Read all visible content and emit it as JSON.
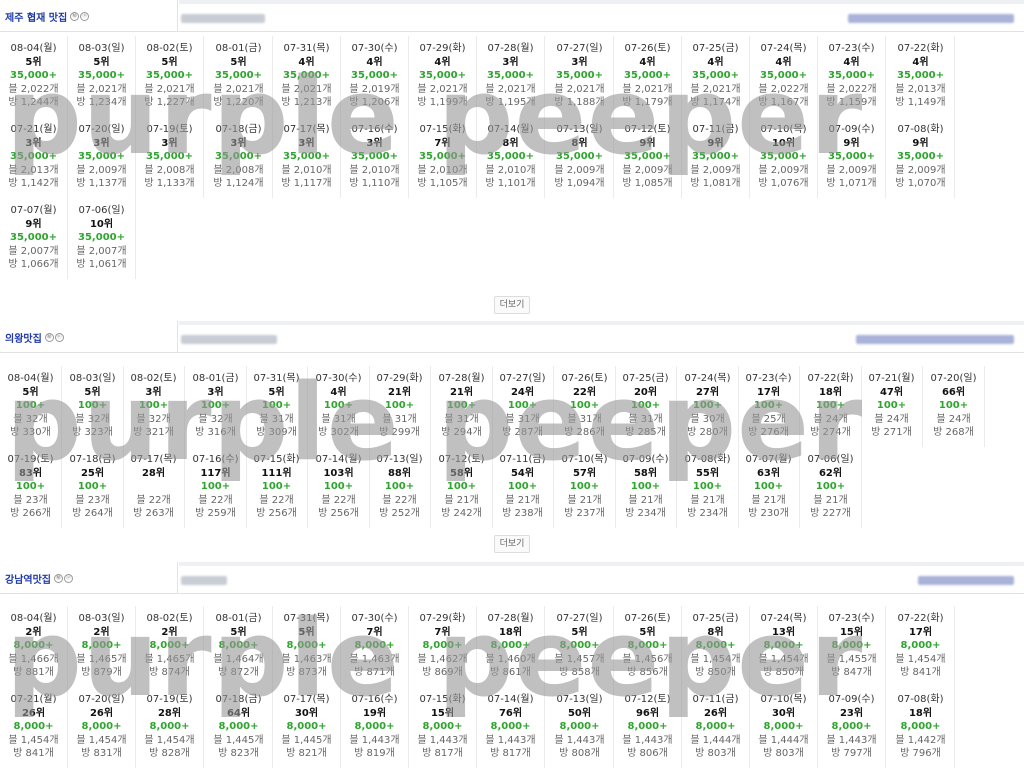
{
  "more_label": "더보기",
  "watermark_text": "purple peeper",
  "colors": {
    "keyword": "#1f3aa8",
    "price": "#2fa52f"
  },
  "sections": [
    {
      "title": "제주 협재 맛집",
      "badges": [
        "㊙",
        "ⓟ"
      ],
      "items": [
        {
          "date": "08-04(월)",
          "rank": "5위",
          "price": "35,000+",
          "blog": "블 2,022개",
          "cafe": "방 1,244개"
        },
        {
          "date": "08-03(일)",
          "rank": "5위",
          "price": "35,000+",
          "blog": "블 2,021개",
          "cafe": "방 1,234개"
        },
        {
          "date": "08-02(토)",
          "rank": "5위",
          "price": "35,000+",
          "blog": "블 2,021개",
          "cafe": "방 1,227개"
        },
        {
          "date": "08-01(금)",
          "rank": "5위",
          "price": "35,000+",
          "blog": "블 2,021개",
          "cafe": "방 1,220개"
        },
        {
          "date": "07-31(목)",
          "rank": "4위",
          "price": "35,000+",
          "blog": "블 2,021개",
          "cafe": "방 1,213개"
        },
        {
          "date": "07-30(수)",
          "rank": "4위",
          "price": "35,000+",
          "blog": "블 2,019개",
          "cafe": "방 1,206개"
        },
        {
          "date": "07-29(화)",
          "rank": "4위",
          "price": "35,000+",
          "blog": "블 2,021개",
          "cafe": "방 1,199개"
        },
        {
          "date": "07-28(월)",
          "rank": "3위",
          "price": "35,000+",
          "blog": "블 2,021개",
          "cafe": "방 1,195개"
        },
        {
          "date": "07-27(일)",
          "rank": "3위",
          "price": "35,000+",
          "blog": "블 2,021개",
          "cafe": "방 1,188개"
        },
        {
          "date": "07-26(토)",
          "rank": "4위",
          "price": "35,000+",
          "blog": "블 2,021개",
          "cafe": "방 1,179개"
        },
        {
          "date": "07-25(금)",
          "rank": "4위",
          "price": "35,000+",
          "blog": "블 2,021개",
          "cafe": "방 1,174개"
        },
        {
          "date": "07-24(목)",
          "rank": "4위",
          "price": "35,000+",
          "blog": "블 2,022개",
          "cafe": "방 1,167개"
        },
        {
          "date": "07-23(수)",
          "rank": "4위",
          "price": "35,000+",
          "blog": "블 2,022개",
          "cafe": "방 1,159개"
        },
        {
          "date": "07-22(화)",
          "rank": "4위",
          "price": "35,000+",
          "blog": "블 2,013개",
          "cafe": "방 1,149개"
        },
        {
          "date": "07-21(월)",
          "rank": "3위",
          "price": "35,000+",
          "blog": "블 2,013개",
          "cafe": "방 1,142개"
        },
        {
          "date": "07-20(일)",
          "rank": "3위",
          "price": "35,000+",
          "blog": "블 2,009개",
          "cafe": "방 1,137개"
        },
        {
          "date": "07-19(토)",
          "rank": "3위",
          "price": "35,000+",
          "blog": "블 2,008개",
          "cafe": "방 1,133개"
        },
        {
          "date": "07-18(금)",
          "rank": "3위",
          "price": "35,000+",
          "blog": "블 2,008개",
          "cafe": "방 1,124개"
        },
        {
          "date": "07-17(목)",
          "rank": "3위",
          "price": "35,000+",
          "blog": "블 2,010개",
          "cafe": "방 1,117개"
        },
        {
          "date": "07-16(수)",
          "rank": "3위",
          "price": "35,000+",
          "blog": "블 2,010개",
          "cafe": "방 1,110개"
        },
        {
          "date": "07-15(화)",
          "rank": "7위",
          "price": "35,000+",
          "blog": "블 2,010개",
          "cafe": "방 1,105개"
        },
        {
          "date": "07-14(월)",
          "rank": "8위",
          "price": "35,000+",
          "blog": "블 2,010개",
          "cafe": "방 1,101개"
        },
        {
          "date": "07-13(일)",
          "rank": "8위",
          "price": "35,000+",
          "blog": "블 2,009개",
          "cafe": "방 1,094개"
        },
        {
          "date": "07-12(토)",
          "rank": "9위",
          "price": "35,000+",
          "blog": "블 2,009개",
          "cafe": "방 1,085개"
        },
        {
          "date": "07-11(금)",
          "rank": "9위",
          "price": "35,000+",
          "blog": "블 2,009개",
          "cafe": "방 1,081개"
        },
        {
          "date": "07-10(목)",
          "rank": "10위",
          "price": "35,000+",
          "blog": "블 2,009개",
          "cafe": "방 1,076개"
        },
        {
          "date": "07-09(수)",
          "rank": "9위",
          "price": "35,000+",
          "blog": "블 2,009개",
          "cafe": "방 1,071개"
        },
        {
          "date": "07-08(화)",
          "rank": "9위",
          "price": "35,000+",
          "blog": "블 2,009개",
          "cafe": "방 1,070개"
        },
        {
          "date": "07-07(월)",
          "rank": "9위",
          "price": "35,000+",
          "blog": "블 2,007개",
          "cafe": "방 1,066개"
        },
        {
          "date": "07-06(일)",
          "rank": "10위",
          "price": "35,000+",
          "blog": "블 2,007개",
          "cafe": "방 1,061개"
        }
      ]
    },
    {
      "title": "의왕맛집",
      "badges": [
        "㊙",
        "ⓟ"
      ],
      "items": [
        {
          "date": "08-04(월)",
          "rank": "5위",
          "price": "100+",
          "blog": "블 32개",
          "cafe": "방 330개"
        },
        {
          "date": "08-03(일)",
          "rank": "5위",
          "price": "100+",
          "blog": "블 32개",
          "cafe": "방 323개"
        },
        {
          "date": "08-02(토)",
          "rank": "3위",
          "price": "100+",
          "blog": "블 32개",
          "cafe": "방 321개"
        },
        {
          "date": "08-01(금)",
          "rank": "3위",
          "price": "100+",
          "blog": "블 32개",
          "cafe": "방 316개"
        },
        {
          "date": "07-31(목)",
          "rank": "5위",
          "price": "100+",
          "blog": "블 31개",
          "cafe": "방 309개"
        },
        {
          "date": "07-30(수)",
          "rank": "4위",
          "price": "100+",
          "blog": "블 31개",
          "cafe": "방 302개"
        },
        {
          "date": "07-29(화)",
          "rank": "21위",
          "price": "100+",
          "blog": "블 31개",
          "cafe": "방 299개"
        },
        {
          "date": "07-28(월)",
          "rank": "21위",
          "price": "100+",
          "blog": "블 31개",
          "cafe": "방 294개"
        },
        {
          "date": "07-27(일)",
          "rank": "24위",
          "price": "100+",
          "blog": "블 31개",
          "cafe": "방 287개"
        },
        {
          "date": "07-26(토)",
          "rank": "22위",
          "price": "100+",
          "blog": "블 31개",
          "cafe": "방 286개"
        },
        {
          "date": "07-25(금)",
          "rank": "20위",
          "price": "100+",
          "blog": "블 31개",
          "cafe": "방 285개"
        },
        {
          "date": "07-24(목)",
          "rank": "27위",
          "price": "100+",
          "blog": "블 30개",
          "cafe": "방 280개"
        },
        {
          "date": "07-23(수)",
          "rank": "17위",
          "price": "100+",
          "blog": "블 25개",
          "cafe": "방 276개"
        },
        {
          "date": "07-22(화)",
          "rank": "18위",
          "price": "100+",
          "blog": "블 24개",
          "cafe": "방 274개"
        },
        {
          "date": "07-21(월)",
          "rank": "47위",
          "price": "100+",
          "blog": "블 24개",
          "cafe": "방 271개"
        },
        {
          "date": "07-20(일)",
          "rank": "66위",
          "price": "100+",
          "blog": "블 24개",
          "cafe": "방 268개"
        },
        {
          "date": "07-19(토)",
          "rank": "83위",
          "price": "100+",
          "blog": "블 23개",
          "cafe": "방 266개"
        },
        {
          "date": "07-18(금)",
          "rank": "25위",
          "price": "100+",
          "blog": "블 23개",
          "cafe": "방 264개"
        },
        {
          "date": "07-17(목)",
          "rank": "28위",
          "price": "",
          "blog": "블 22개",
          "cafe": "방 263개"
        },
        {
          "date": "07-16(수)",
          "rank": "117위",
          "price": "100+",
          "blog": "블 22개",
          "cafe": "방 259개"
        },
        {
          "date": "07-15(화)",
          "rank": "111위",
          "price": "100+",
          "blog": "블 22개",
          "cafe": "방 256개"
        },
        {
          "date": "07-14(월)",
          "rank": "103위",
          "price": "100+",
          "blog": "블 22개",
          "cafe": "방 256개"
        },
        {
          "date": "07-13(일)",
          "rank": "88위",
          "price": "100+",
          "blog": "블 22개",
          "cafe": "방 252개"
        },
        {
          "date": "07-12(토)",
          "rank": "58위",
          "price": "100+",
          "blog": "블 21개",
          "cafe": "방 242개"
        },
        {
          "date": "07-11(금)",
          "rank": "54위",
          "price": "100+",
          "blog": "블 21개",
          "cafe": "방 238개"
        },
        {
          "date": "07-10(목)",
          "rank": "57위",
          "price": "100+",
          "blog": "블 21개",
          "cafe": "방 237개"
        },
        {
          "date": "07-09(수)",
          "rank": "58위",
          "price": "100+",
          "blog": "블 21개",
          "cafe": "방 234개"
        },
        {
          "date": "07-08(화)",
          "rank": "55위",
          "price": "100+",
          "blog": "블 21개",
          "cafe": "방 234개"
        },
        {
          "date": "07-07(월)",
          "rank": "63위",
          "price": "100+",
          "blog": "블 21개",
          "cafe": "방 230개"
        },
        {
          "date": "07-06(일)",
          "rank": "62위",
          "price": "100+",
          "blog": "블 21개",
          "cafe": "방 227개"
        }
      ]
    },
    {
      "title": "강남역맛집",
      "badges": [
        "㊙",
        "ⓟ"
      ],
      "items": [
        {
          "date": "08-04(월)",
          "rank": "2위",
          "price": "8,000+",
          "blog": "블 1,466개",
          "cafe": "방 881개"
        },
        {
          "date": "08-03(일)",
          "rank": "2위",
          "price": "8,000+",
          "blog": "블 1,465개",
          "cafe": "방 879개"
        },
        {
          "date": "08-02(토)",
          "rank": "2위",
          "price": "8,000+",
          "blog": "블 1,465개",
          "cafe": "방 874개"
        },
        {
          "date": "08-01(금)",
          "rank": "5위",
          "price": "8,000+",
          "blog": "블 1,464개",
          "cafe": "방 872개"
        },
        {
          "date": "07-31(목)",
          "rank": "5위",
          "price": "8,000+",
          "blog": "블 1,463개",
          "cafe": "방 873개"
        },
        {
          "date": "07-30(수)",
          "rank": "7위",
          "price": "8,000+",
          "blog": "블 1,463개",
          "cafe": "방 871개"
        },
        {
          "date": "07-29(화)",
          "rank": "7위",
          "price": "8,000+",
          "blog": "블 1,462개",
          "cafe": "방 869개"
        },
        {
          "date": "07-28(월)",
          "rank": "18위",
          "price": "8,000+",
          "blog": "블 1,460개",
          "cafe": "방 861개"
        },
        {
          "date": "07-27(일)",
          "rank": "5위",
          "price": "8,000+",
          "blog": "블 1,457개",
          "cafe": "방 858개"
        },
        {
          "date": "07-26(토)",
          "rank": "5위",
          "price": "8,000+",
          "blog": "블 1,456개",
          "cafe": "방 856개"
        },
        {
          "date": "07-25(금)",
          "rank": "8위",
          "price": "8,000+",
          "blog": "블 1,454개",
          "cafe": "방 850개"
        },
        {
          "date": "07-24(목)",
          "rank": "13위",
          "price": "8,000+",
          "blog": "블 1,454개",
          "cafe": "방 850개"
        },
        {
          "date": "07-23(수)",
          "rank": "15위",
          "price": "8,000+",
          "blog": "블 1,455개",
          "cafe": "방 847개"
        },
        {
          "date": "07-22(화)",
          "rank": "17위",
          "price": "8,000+",
          "blog": "블 1,454개",
          "cafe": "방 841개"
        },
        {
          "date": "07-21(월)",
          "rank": "26위",
          "price": "8,000+",
          "blog": "블 1,454개",
          "cafe": "방 841개"
        },
        {
          "date": "07-20(일)",
          "rank": "26위",
          "price": "8,000+",
          "blog": "블 1,454개",
          "cafe": "방 831개"
        },
        {
          "date": "07-19(토)",
          "rank": "28위",
          "price": "8,000+",
          "blog": "블 1,454개",
          "cafe": "방 828개"
        },
        {
          "date": "07-18(금)",
          "rank": "64위",
          "price": "8,000+",
          "blog": "블 1,445개",
          "cafe": "방 823개"
        },
        {
          "date": "07-17(목)",
          "rank": "30위",
          "price": "8,000+",
          "blog": "블 1,445개",
          "cafe": "방 821개"
        },
        {
          "date": "07-16(수)",
          "rank": "19위",
          "price": "8,000+",
          "blog": "블 1,443개",
          "cafe": "방 819개"
        },
        {
          "date": "07-15(화)",
          "rank": "15위",
          "price": "8,000+",
          "blog": "블 1,443개",
          "cafe": "방 817개"
        },
        {
          "date": "07-14(월)",
          "rank": "76위",
          "price": "8,000+",
          "blog": "블 1,443개",
          "cafe": "방 817개"
        },
        {
          "date": "07-13(일)",
          "rank": "50위",
          "price": "8,000+",
          "blog": "블 1,443개",
          "cafe": "방 808개"
        },
        {
          "date": "07-12(토)",
          "rank": "96위",
          "price": "8,000+",
          "blog": "블 1,443개",
          "cafe": "방 806개"
        },
        {
          "date": "07-11(금)",
          "rank": "26위",
          "price": "8,000+",
          "blog": "블 1,444개",
          "cafe": "방 803개"
        },
        {
          "date": "07-10(목)",
          "rank": "30위",
          "price": "8,000+",
          "blog": "블 1,444개",
          "cafe": "방 803개"
        },
        {
          "date": "07-09(수)",
          "rank": "23위",
          "price": "8,000+",
          "blog": "블 1,443개",
          "cafe": "방 797개"
        },
        {
          "date": "07-08(화)",
          "rank": "18위",
          "price": "8,000+",
          "blog": "블 1,442개",
          "cafe": "방 796개"
        }
      ]
    }
  ]
}
